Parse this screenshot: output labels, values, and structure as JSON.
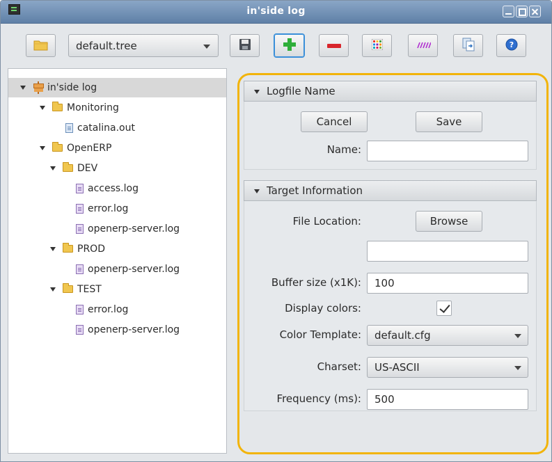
{
  "window": {
    "title": "in'side log",
    "buttons": [
      "minimize",
      "maximize",
      "close"
    ]
  },
  "toolbar": {
    "file_selector_value": "default.tree",
    "icons": [
      "open-folder-icon",
      "save-icon",
      "add-icon",
      "remove-icon",
      "color-grid-icon",
      "pattern-icon",
      "copy-icon",
      "help-icon"
    ]
  },
  "tree": {
    "root": "in'side log",
    "monitoring": "Monitoring",
    "catalina": "catalina.out",
    "openerp": "OpenERP",
    "dev": "DEV",
    "dev_access": "access.log",
    "dev_error": "error.log",
    "dev_server": "openerp-server.log",
    "prod": "PROD",
    "prod_server": "openerp-server.log",
    "test": "TEST",
    "test_error": "error.log",
    "test_server": "openerp-server.log"
  },
  "logfile_section": {
    "title": "Logfile Name",
    "cancel_label": "Cancel",
    "save_label": "Save",
    "name_label": "Name:",
    "name_value": ""
  },
  "target_section": {
    "title": "Target Information",
    "file_location_label": "File Location:",
    "browse_label": "Browse",
    "file_location_value": "",
    "buffer_label": "Buffer size (x1K):",
    "buffer_value": "100",
    "display_colors_label": "Display colors:",
    "display_colors_checked": true,
    "color_template_label": "Color Template:",
    "color_template_value": "default.cfg",
    "charset_label": "Charset:",
    "charset_value": "US-ASCII",
    "frequency_label": "Frequency (ms):",
    "frequency_value": "500"
  },
  "colors": {
    "highlight_border": "#f2b40a",
    "titlebar": "#6f8fb5",
    "selection": "#d8d8d8"
  }
}
